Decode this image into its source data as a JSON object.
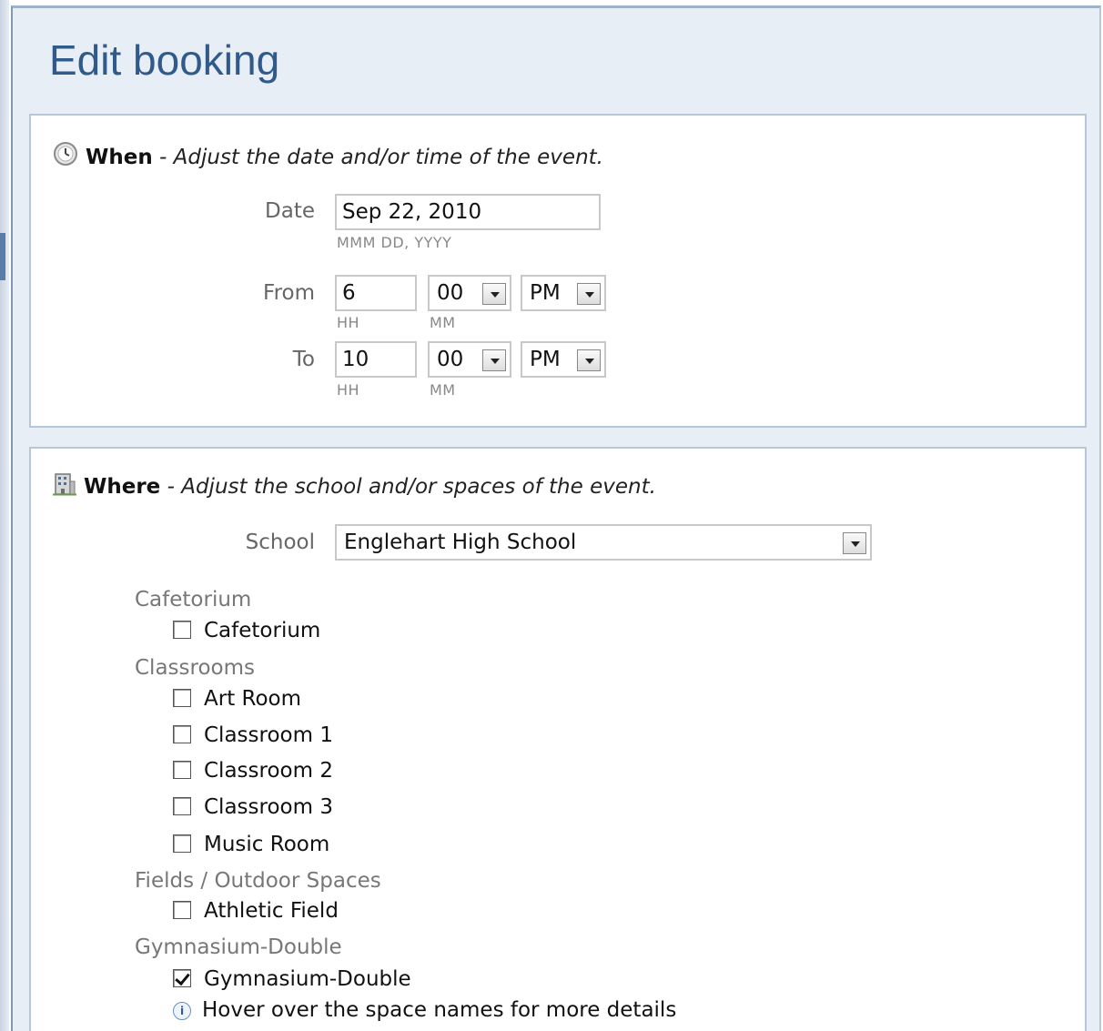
{
  "title": "Edit booking",
  "when": {
    "heading": "When",
    "subtitle": " - Adjust the date and/or time of the event.",
    "date_label": "Date",
    "date_value": "Sep 22, 2010",
    "date_hint": "MMM DD, YYYY",
    "from_label": "From",
    "from_hour": "6",
    "from_minute": "00",
    "from_ampm": "PM",
    "to_label": "To",
    "to_hour": "10",
    "to_minute": "00",
    "to_ampm": "PM",
    "hour_hint": "HH",
    "minute_hint": "MM"
  },
  "where": {
    "heading": "Where",
    "subtitle": " - Adjust the school and/or spaces of the event.",
    "school_label": "School",
    "school_value": "Englehart High School",
    "groups": [
      {
        "label": "Cafetorium",
        "spaces": [
          {
            "label": "Cafetorium",
            "checked": false
          }
        ]
      },
      {
        "label": "Classrooms",
        "spaces": [
          {
            "label": "Art Room",
            "checked": false
          },
          {
            "label": "Classroom 1",
            "checked": false
          },
          {
            "label": "Classroom 2",
            "checked": false
          },
          {
            "label": "Classroom 3",
            "checked": false
          },
          {
            "label": "Music Room",
            "checked": false
          }
        ]
      },
      {
        "label": "Fields / Outdoor Spaces",
        "spaces": [
          {
            "label": "Athletic Field",
            "checked": false
          }
        ]
      },
      {
        "label": "Gymnasium-Double",
        "spaces": [
          {
            "label": "Gymnasium-Double",
            "checked": true
          }
        ]
      }
    ],
    "hover_hint": "Hover over the space names for more details"
  }
}
